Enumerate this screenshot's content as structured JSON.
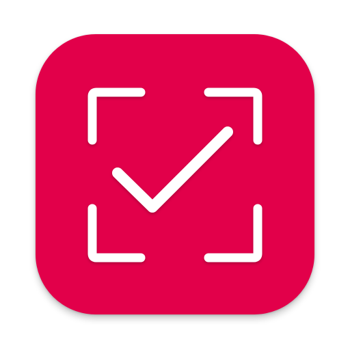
{
  "icon": {
    "name": "scan-check-app-icon",
    "glyph": "viewfinder-checkmark-icon",
    "background_color": "#E2004A",
    "foreground_color": "#FFFFFF"
  }
}
